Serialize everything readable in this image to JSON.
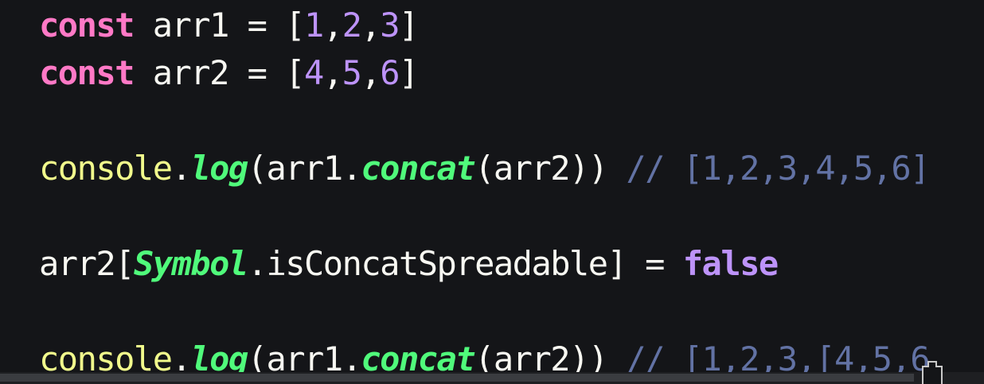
{
  "colors": {
    "background": "#141518",
    "keyword": "#ff79c6",
    "number": "#bd93f9",
    "object": "#f1fa8c",
    "function": "#50fa7b",
    "comment": "#6272a4",
    "text": "#f8f8f2"
  },
  "code": {
    "line1": {
      "kw": "const",
      "pre": " arr1 = [",
      "n1": "1",
      "c1": ",",
      "n2": "2",
      "c2": ",",
      "n3": "3",
      "post": "]"
    },
    "line2": {
      "kw": "const",
      "pre": " arr2 = [",
      "n1": "4",
      "c1": ",",
      "n2": "5",
      "c2": ",",
      "n3": "6",
      "post": "]"
    },
    "line4": {
      "obj": "console",
      "dot1": ".",
      "fn1": "log",
      "mid1": "(arr1.",
      "fn2": "concat",
      "mid2": "(arr2)) ",
      "comment": "// [1,2,3,4,5,6]"
    },
    "line6": {
      "pre": "arr2[",
      "sym": "Symbol",
      "mid": ".isConcatSpreadable] = ",
      "bool": "false"
    },
    "line8": {
      "obj": "console",
      "dot1": ".",
      "fn1": "log",
      "mid1": "(arr1.",
      "fn2": "concat",
      "mid2": "(arr2)) ",
      "comment": "// [1,2,3,[4,5,6"
    }
  },
  "scrollbar": {
    "orientation": "horizontal",
    "position": 0
  },
  "icons": {
    "corner": "window-restore-icon"
  }
}
